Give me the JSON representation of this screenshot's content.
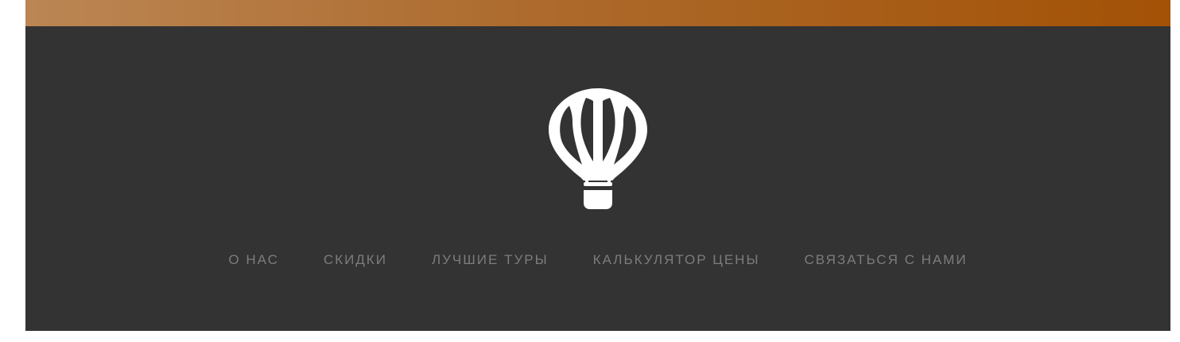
{
  "header": {
    "logo_icon": "hot-air-balloon-icon",
    "accent_gradient": [
      "#bb8654",
      "#a35206"
    ],
    "background": "#333333",
    "nav_color": "#7c7c7c"
  },
  "nav": {
    "items": [
      {
        "label": "О НАС"
      },
      {
        "label": "СКИДКИ"
      },
      {
        "label": "ЛУЧШИЕ ТУРЫ"
      },
      {
        "label": "КАЛЬКУЛЯТОР ЦЕНЫ"
      },
      {
        "label": "СВЯЗАТЬСЯ С НАМИ"
      }
    ]
  }
}
